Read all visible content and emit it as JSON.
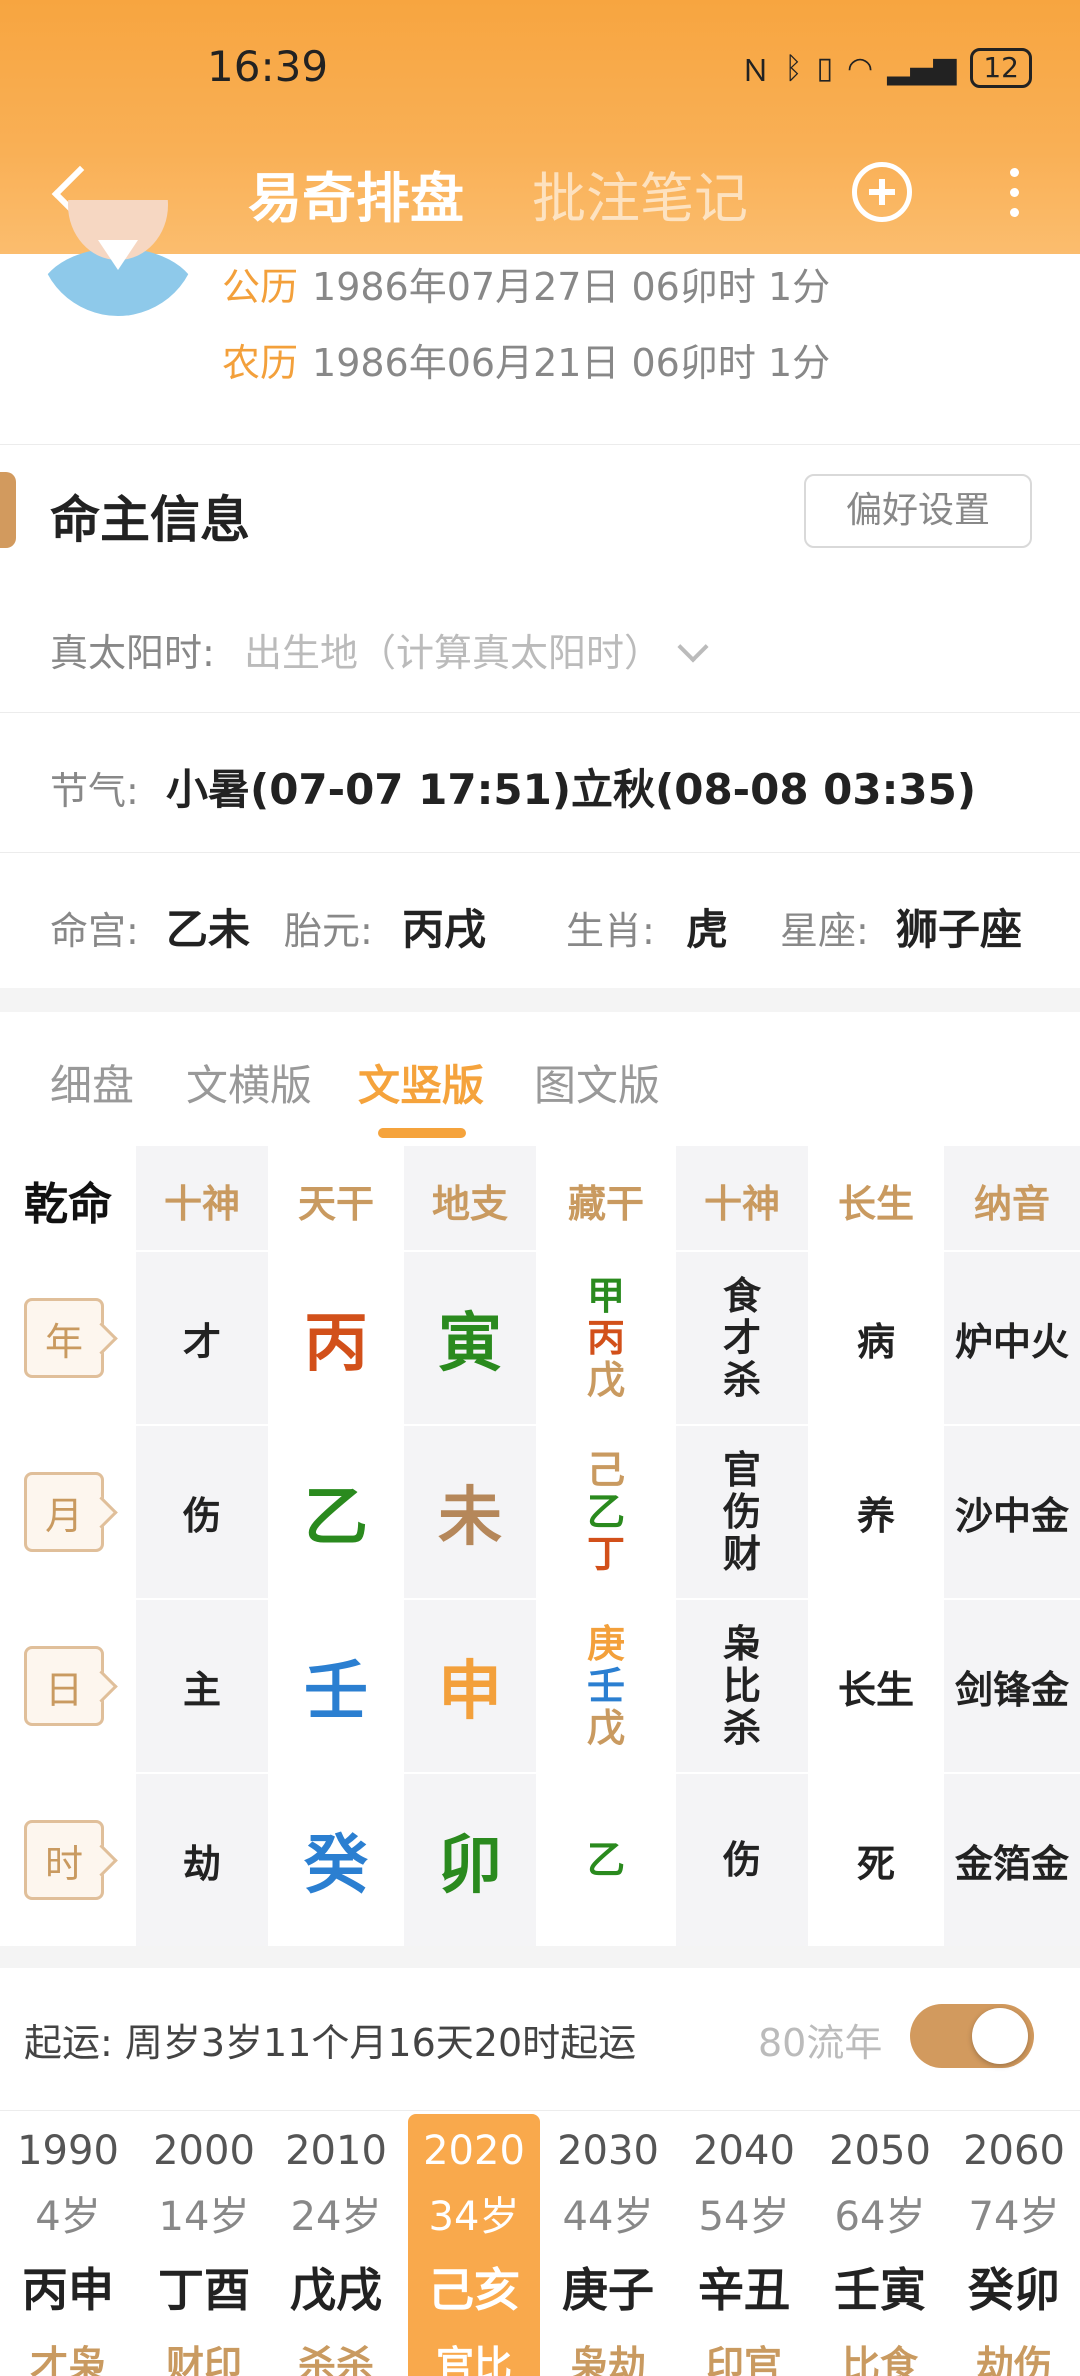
{
  "status": {
    "time": "16:39",
    "icons": [
      "nfc-icon",
      "bluetooth-icon",
      "vibrate-icon",
      "wifi-icon",
      "signal-5g-icon"
    ],
    "battery": "12"
  },
  "nav": {
    "title": "易奇排盘",
    "notes": "批注笔记"
  },
  "profile": {
    "solar_label": "公历",
    "solar_value": "1986年07月27日 06卯时 1分",
    "lunar_label": "农历",
    "lunar_value": "1986年06月21日 06卯时 1分"
  },
  "info": {
    "title": "命主信息",
    "pref_button": "偏好设置",
    "true_solar_label": "真太阳时:",
    "true_solar_placeholder": "出生地（计算真太阳时）",
    "jieqi_label": "节气:",
    "jieqi_value": "小暑(07-07 17:51)立秋(08-08 03:35)",
    "minggong_label": "命宫:",
    "minggong_value": "乙未",
    "taiyuan_label": "胎元:",
    "taiyuan_value": "丙戌",
    "shengxiao_label": "生肖:",
    "shengxiao_value": "虎",
    "xingzuo_label": "星座:",
    "xingzuo_value": "狮子座"
  },
  "view_tabs": [
    "细盘",
    "文横版",
    "文竖版",
    "图文版"
  ],
  "active_view_tab": "文竖版",
  "table": {
    "headers": [
      "乾命",
      "十神",
      "天干",
      "地支",
      "藏干",
      "十神",
      "长生",
      "纳音"
    ],
    "rows": [
      {
        "pillar": "年",
        "shishen": "才",
        "tiangan": "丙",
        "tiangan_color": "#d2501a",
        "dizhi": "寅",
        "dizhi_color": "#2a8a1e",
        "canggan": [
          {
            "c": "甲",
            "color": "#2a8a1e"
          },
          {
            "c": "丙",
            "color": "#d2501a"
          },
          {
            "c": "戊",
            "color": "#c99a60"
          }
        ],
        "shishen2": [
          "食",
          "才",
          "杀"
        ],
        "changsheng": "病",
        "nayin": "炉中火"
      },
      {
        "pillar": "月",
        "shishen": "伤",
        "tiangan": "乙",
        "tiangan_color": "#2a8a1e",
        "dizhi": "未",
        "dizhi_color": "#b5875a",
        "canggan": [
          {
            "c": "己",
            "color": "#c99a60"
          },
          {
            "c": "乙",
            "color": "#2a8a1e"
          },
          {
            "c": "丁",
            "color": "#d2501a"
          }
        ],
        "shishen2": [
          "官",
          "伤",
          "财"
        ],
        "changsheng": "养",
        "nayin": "沙中金"
      },
      {
        "pillar": "日",
        "shishen": "主",
        "tiangan": "壬",
        "tiangan_color": "#2b7fd1",
        "dizhi": "申",
        "dizhi_color": "#f3a03b",
        "canggan": [
          {
            "c": "庚",
            "color": "#f3a03b"
          },
          {
            "c": "壬",
            "color": "#2b7fd1"
          },
          {
            "c": "戊",
            "color": "#c99a60"
          }
        ],
        "shishen2": [
          "枭",
          "比",
          "杀"
        ],
        "changsheng": "长生",
        "nayin": "剑锋金"
      },
      {
        "pillar": "时",
        "shishen": "劫",
        "tiangan": "癸",
        "tiangan_color": "#2b7fd1",
        "dizhi": "卯",
        "dizhi_color": "#2a8a1e",
        "canggan": [
          {
            "c": "乙",
            "color": "#2a8a1e"
          }
        ],
        "shishen2": [
          "伤"
        ],
        "changsheng": "死",
        "nayin": "金箔金"
      }
    ]
  },
  "luck": {
    "qiyun": "起运: 周岁3岁11个月16天20时起运",
    "liunian_label": "80流年",
    "toggle_on": true,
    "active_year": "2020",
    "items": [
      {
        "year": "1990",
        "age": "4岁",
        "ganzhi": "丙申",
        "shishen": "才枭"
      },
      {
        "year": "2000",
        "age": "14岁",
        "ganzhi": "丁酉",
        "shishen": "财印"
      },
      {
        "year": "2010",
        "age": "24岁",
        "ganzhi": "戊戌",
        "shishen": "杀杀"
      },
      {
        "year": "2020",
        "age": "34岁",
        "ganzhi": "己亥",
        "shishen": "官比"
      },
      {
        "year": "2030",
        "age": "44岁",
        "ganzhi": "庚子",
        "shishen": "枭劫"
      },
      {
        "year": "2040",
        "age": "54岁",
        "ganzhi": "辛丑",
        "shishen": "印官"
      },
      {
        "year": "2050",
        "age": "64岁",
        "ganzhi": "壬寅",
        "shishen": "比食"
      },
      {
        "year": "2060",
        "age": "74岁",
        "ganzhi": "癸卯",
        "shishen": "劫伤"
      }
    ]
  }
}
